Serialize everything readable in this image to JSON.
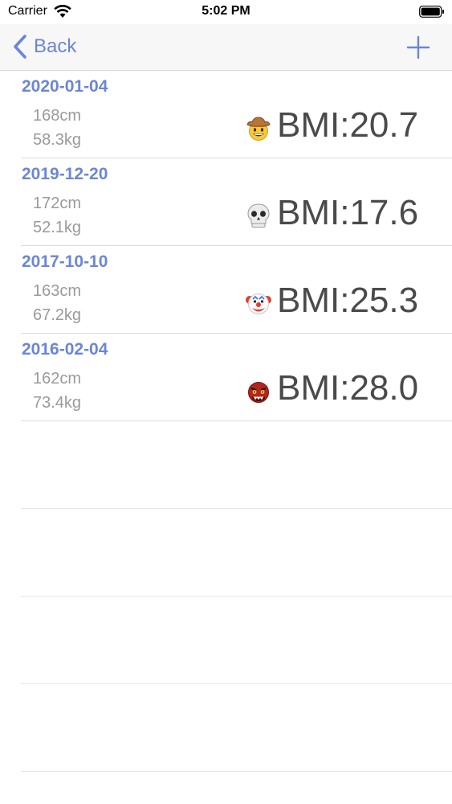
{
  "status": {
    "carrier": "Carrier",
    "time": "5:02 PM"
  },
  "nav": {
    "back_label": "Back",
    "add_icon": "plus-icon"
  },
  "records": [
    {
      "date": "2020-01-04",
      "height": "168cm",
      "weight": "58.3kg",
      "bmi": "BMI:20.7",
      "emoji": "cowboy-hat-face-icon"
    },
    {
      "date": "2019-12-20",
      "height": "172cm",
      "weight": "52.1kg",
      "bmi": "BMI:17.6",
      "emoji": "skull-icon"
    },
    {
      "date": "2017-10-10",
      "height": "163cm",
      "weight": "67.2kg",
      "bmi": "BMI:25.3",
      "emoji": "clown-face-icon"
    },
    {
      "date": "2016-02-04",
      "height": "162cm",
      "weight": "73.4kg",
      "bmi": "BMI:28.0",
      "emoji": "ogre-icon"
    }
  ],
  "colors": {
    "accent": "#6b86d6",
    "secondary_text": "#9a9a9a",
    "bmi_text": "#4a4a4a",
    "nav_bg": "#f7f7f7"
  }
}
